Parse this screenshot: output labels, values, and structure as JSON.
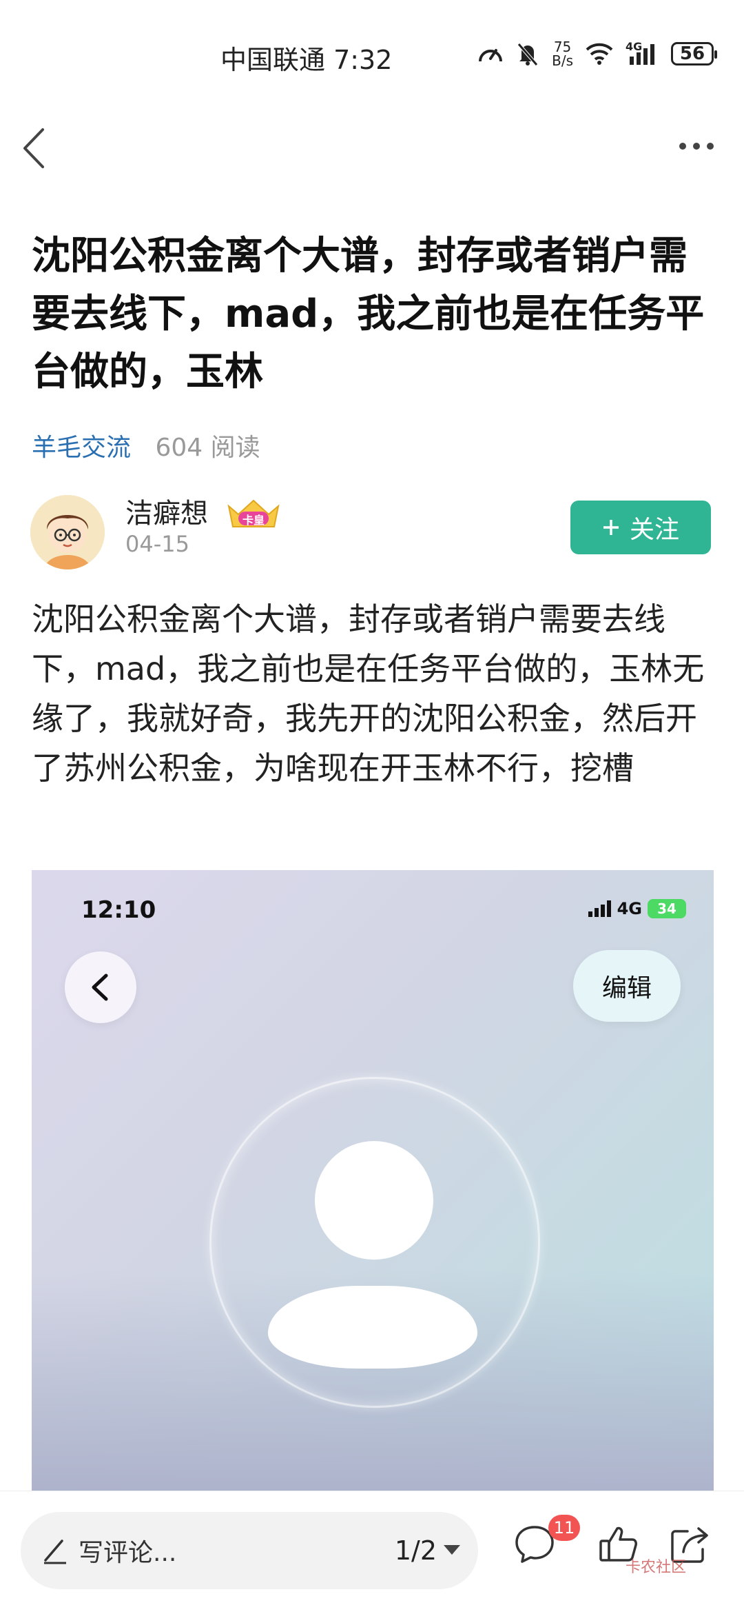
{
  "status_bar": {
    "carrier_time": "中国联通 7:32",
    "net_speed_value": "75",
    "net_speed_unit": "B/s",
    "network_type": "4G",
    "battery": "56"
  },
  "post": {
    "title": "沈阳公积金离个大谱，封存或者销户需要去线下，mad，我之前也是在任务平台做的，玉林",
    "category": "羊毛交流",
    "reads": "604 阅读",
    "author": "洁癖想",
    "author_badge": "卡皇",
    "date": "04-15",
    "follow_label": "关注",
    "body": "沈阳公积金离个大谱，封存或者销户需要去线下，mad，我之前也是在任务平台做的，玉林无缘了，我就好奇，我先开的沈阳公积金，然后开了苏州公积金，为啥现在开玉林不行，挖槽"
  },
  "embedded_screenshot": {
    "time": "12:10",
    "network": "4G",
    "battery": "34",
    "edit_label": "编辑"
  },
  "bottom_bar": {
    "comment_placeholder": "写评论...",
    "page_indicator": "1/2",
    "comment_count": "11",
    "watermark": "卡农社区"
  }
}
